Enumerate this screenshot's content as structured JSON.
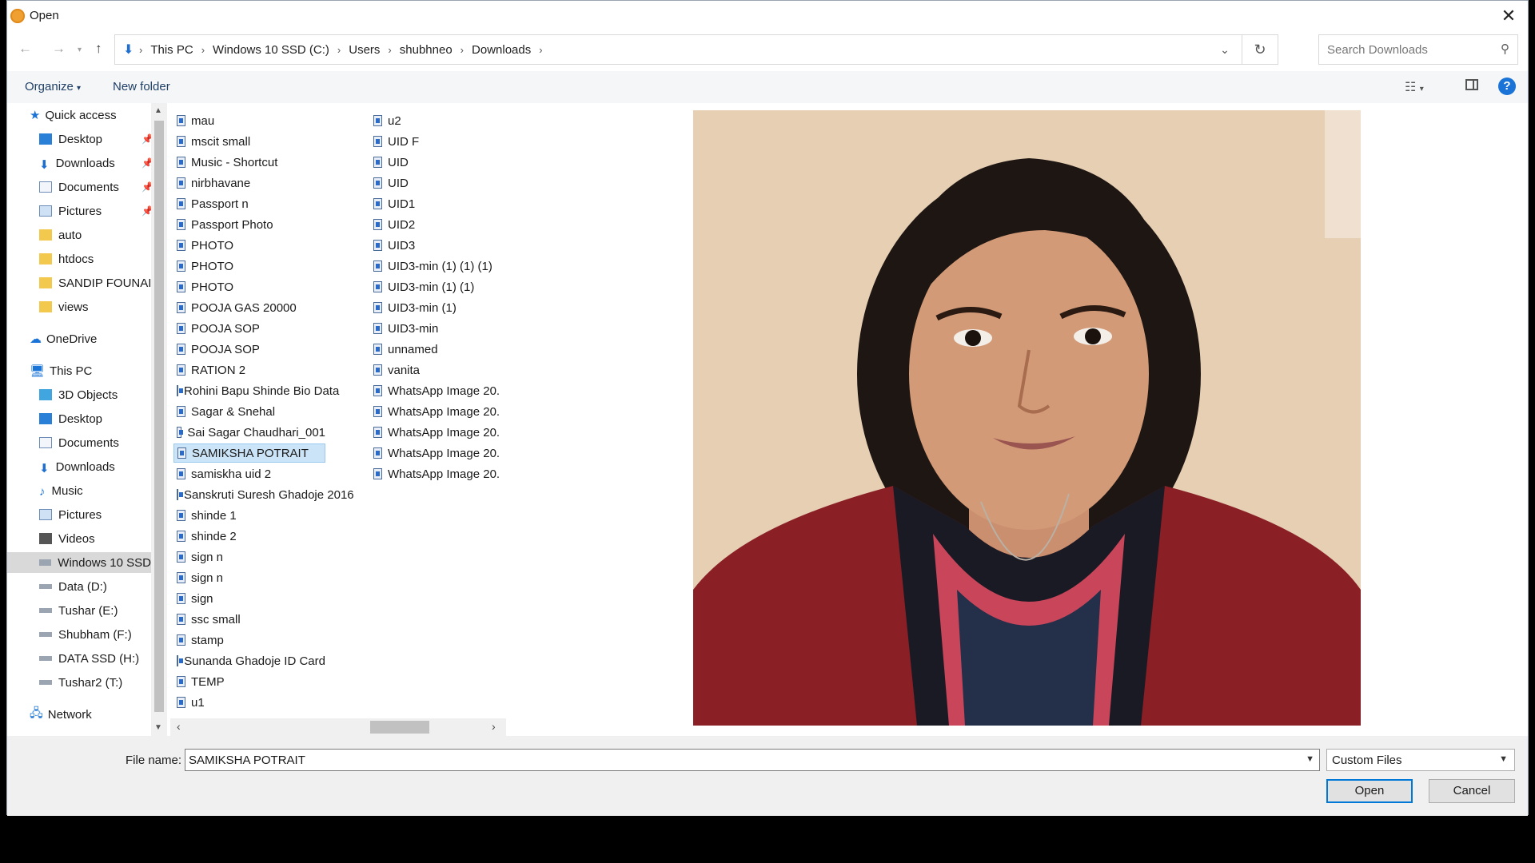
{
  "window": {
    "title": "Open",
    "close_icon": "close-icon"
  },
  "address": {
    "breadcrumbs": [
      "This PC",
      "Windows 10 SSD (C:)",
      "Users",
      "shubhneo",
      "Downloads"
    ]
  },
  "search": {
    "placeholder": "Search Downloads"
  },
  "toolbar": {
    "organize_label": "Organize",
    "new_folder_label": "New folder",
    "help_label": "?"
  },
  "nav": {
    "quick_access": "Quick access",
    "quick_items": [
      {
        "label": "Desktop",
        "pinned": true
      },
      {
        "label": "Downloads",
        "pinned": true
      },
      {
        "label": "Documents",
        "pinned": true
      },
      {
        "label": "Pictures",
        "pinned": true
      },
      {
        "label": "auto"
      },
      {
        "label": "htdocs"
      },
      {
        "label": "SANDIP FOUNAI"
      },
      {
        "label": "views"
      }
    ],
    "onedrive": "OneDrive",
    "this_pc": "This PC",
    "pc_items": [
      "3D Objects",
      "Desktop",
      "Documents",
      "Downloads",
      "Music",
      "Pictures",
      "Videos",
      "Windows 10 SSD",
      "Data (D:)",
      "Tushar (E:)",
      "Shubham (F:)",
      "DATA SSD (H:)",
      "Tushar2 (T:)"
    ],
    "network": "Network"
  },
  "files": {
    "col1": [
      "mau",
      "mscit small",
      "Music - Shortcut",
      "nirbhavane",
      "Passport n",
      "Passport Photo",
      "PHOTO",
      "PHOTO",
      "PHOTO",
      "POOJA GAS 20000",
      "POOJA SOP",
      "POOJA SOP",
      "RATION 2",
      "Rohini Bapu Shinde Bio Data",
      "Sagar & Snehal",
      "Sai Sagar Chaudhari_001",
      "SAMIKSHA POTRAIT",
      "samiskha uid 2",
      "Sanskruti Suresh Ghadoje 2016",
      "shinde 1",
      "shinde 2",
      "sign n",
      "sign n",
      "sign",
      "ssc small",
      "stamp",
      "Sunanda Ghadoje ID Card",
      "TEMP",
      "u1"
    ],
    "col2": [
      "u2",
      "UID F",
      "UID",
      "UID",
      "UID1",
      "UID2",
      "UID3",
      "UID3-min (1) (1) (1)",
      "UID3-min (1) (1)",
      "UID3-min (1)",
      "UID3-min",
      "unnamed",
      "vanita",
      "WhatsApp Image 20.",
      "WhatsApp Image 20.",
      "WhatsApp Image 20.",
      "WhatsApp Image 20.",
      "WhatsApp Image 20."
    ],
    "selected": "SAMIKSHA POTRAIT"
  },
  "bottom": {
    "file_name_label": "File name:",
    "file_name_value": "SAMIKSHA POTRAIT",
    "file_type": "Custom Files",
    "open_label": "Open",
    "cancel_label": "Cancel"
  }
}
